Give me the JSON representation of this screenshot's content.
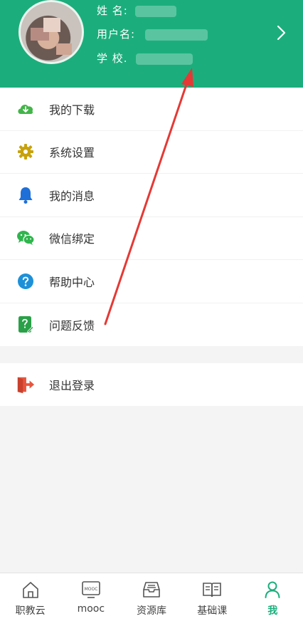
{
  "profile": {
    "name_label": "姓 名:",
    "username_label": "用户名:",
    "school_label": "学 校."
  },
  "menu": {
    "items": [
      {
        "label": "我的下载",
        "icon": "cloud-download-icon"
      },
      {
        "label": "系统设置",
        "icon": "gear-icon"
      },
      {
        "label": "我的消息",
        "icon": "bell-icon"
      },
      {
        "label": "微信绑定",
        "icon": "wechat-icon"
      },
      {
        "label": "帮助中心",
        "icon": "help-icon"
      },
      {
        "label": "问题反馈",
        "icon": "feedback-icon"
      }
    ]
  },
  "logout": {
    "label": "退出登录",
    "icon": "logout-icon"
  },
  "tabbar": {
    "tabs": [
      {
        "label": "职教云",
        "icon": "home-icon"
      },
      {
        "label": "mooc",
        "icon": "mooc-icon",
        "icon_text": "MOOC"
      },
      {
        "label": "资源库",
        "icon": "archive-icon"
      },
      {
        "label": "基础课",
        "icon": "book-icon"
      },
      {
        "label": "我",
        "icon": "person-icon"
      }
    ],
    "active": "我"
  },
  "colors": {
    "brand": "#1bae7c",
    "download": "#43b549",
    "settings": "#c8a20c",
    "message": "#1f6fd8",
    "wechat": "#2fb54d",
    "help": "#1e90d8",
    "feedback": "#2aa148",
    "logout": "#e8553e",
    "annotation_arrow": "#e53935"
  }
}
